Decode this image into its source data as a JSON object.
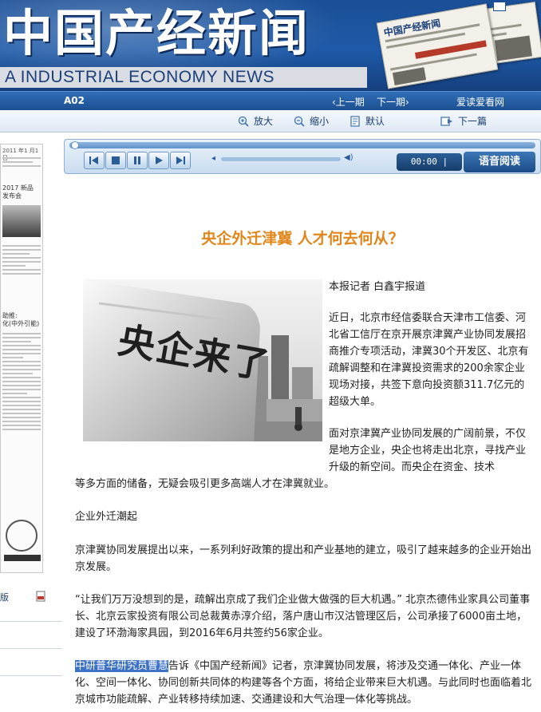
{
  "masthead": {
    "title_cn": "中国产经新闻",
    "title_en": "A INDUSTRIAL ECONOMY NEWS",
    "paper_titles": [
      "中国产经新闻",
      "新闻"
    ]
  },
  "navbar": {
    "page": "A02",
    "prev": "‹上一期",
    "next": "下一期›",
    "love": "爱读爱看网"
  },
  "toolbar": {
    "zoom_in": "放大",
    "zoom_out": "缩小",
    "default": "默认",
    "next_article": "下一篇"
  },
  "player": {
    "time": "00:00 | 00:00",
    "read_label": "语音阅读",
    "progress": 0
  },
  "left": {
    "thumb_snippets": [
      "2017 新品",
      "发布会",
      "助推:",
      "化(中外引能)"
    ],
    "version": "版"
  },
  "article": {
    "headline": "央企外迁津冀  人才何去何从？",
    "photo_text": "央企来了",
    "byline": "本报记者  白鑫宇报道",
    "p1": "近日，北京市经信委联合天津市工信委、河北省工信厅在京开展京津冀产业协同发展招商推介专项活动，津冀30个开发区、北京有疏解调整和在津冀投资需求的200余家企业现场对接，共签下意向投资额311.7亿元的超级大单。",
    "p2a": "面对京津冀产业协同发展的广阔前景，不仅是地方企业，央企也将走出北京，寻找产业升级的新空间。而央企在资金、技术",
    "p2b": "等多方面的储备，无疑会吸引更多高端人才在津冀就业。",
    "subhead": "企业外迁潮起",
    "p3": "京津冀协同发展提出以来，一系列利好政策的提出和产业基地的建立，吸引了越来越多的企业开始出京发展。",
    "p4": "“让我们万万没想到的是，疏解出京成了我们企业做大做强的巨大机遇。” 北京杰德伟业家具公司董事长、北京云家投资有限公司总裁黄赤淳介绍，落户唐山市汉沽管理区后，公司承接了6000亩土地，建设了环渤海家具园，到2016年6月共签约56家企业。",
    "p5_highlight": "中研普华研究员曹慧",
    "p5_rest": "告诉《中国产经新闻》记者，京津冀协同发展，将涉及交通一体化、产业一体化、空间一体化、协同创新共同体的构建等各个方面，将给企业带来巨大机遇。与此同时也面临着北京城市功能疏解、产业转移持续加速、交通建设和大气治理一体化等挑战。"
  }
}
